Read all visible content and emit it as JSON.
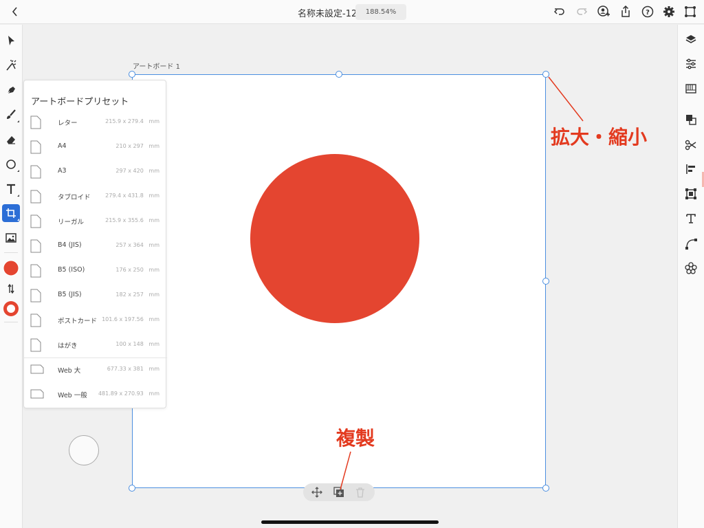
{
  "document": {
    "title": "名称未設定-12",
    "zoom": "188.54%"
  },
  "artboard": {
    "label": "アートボード 1"
  },
  "presets": {
    "title": "アートボードプリセット",
    "items": [
      {
        "name": "レター",
        "size": "215.9 x 279.4   mm"
      },
      {
        "name": "A4",
        "size": "210 x 297   mm"
      },
      {
        "name": "A3",
        "size": "297 x 420   mm"
      },
      {
        "name": "タブロイド",
        "size": "279.4 x 431.8   mm"
      },
      {
        "name": "リーガル",
        "size": "215.9 x 355.6   mm"
      },
      {
        "name": "B4 (JIS)",
        "size": "257 x 364   mm"
      },
      {
        "name": "B5 (ISO)",
        "size": "176 x 250   mm"
      },
      {
        "name": "B5 (JIS)",
        "size": "182 x 257   mm"
      },
      {
        "name": "ポストカード",
        "size": "101.6 x 197.56   mm"
      },
      {
        "name": "はがき",
        "size": "100 x 148   mm"
      },
      {
        "name": "Web 大",
        "size": "677.33 x 381   mm"
      },
      {
        "name": "Web 一般",
        "size": "481.89 x 270.93   mm"
      }
    ]
  },
  "annotations": {
    "scale": "拡大・縮小",
    "duplicate": "複製"
  },
  "colors": {
    "fill": "#e44530",
    "stroke": "#e44530",
    "accent": "#2c6ed6",
    "annotation": "#e33a1f"
  },
  "icons": {
    "top": [
      "back-icon",
      "undo-icon",
      "redo-icon",
      "invite-icon",
      "share-icon",
      "help-icon",
      "settings-icon",
      "touch-shortcut-icon"
    ],
    "left": [
      "selection-icon",
      "direct-selection-icon",
      "pen-icon",
      "paintbrush-icon",
      "eraser-icon",
      "ellipse-icon",
      "type-icon",
      "artboard-icon",
      "image-icon",
      "swap-icon"
    ],
    "right": [
      "layers-icon",
      "properties-icon",
      "libraries-icon",
      "pathfinder-icon",
      "cut-icon",
      "align-icon",
      "transform-icon",
      "type-props-icon",
      "path-icon",
      "repeat-icon"
    ]
  }
}
